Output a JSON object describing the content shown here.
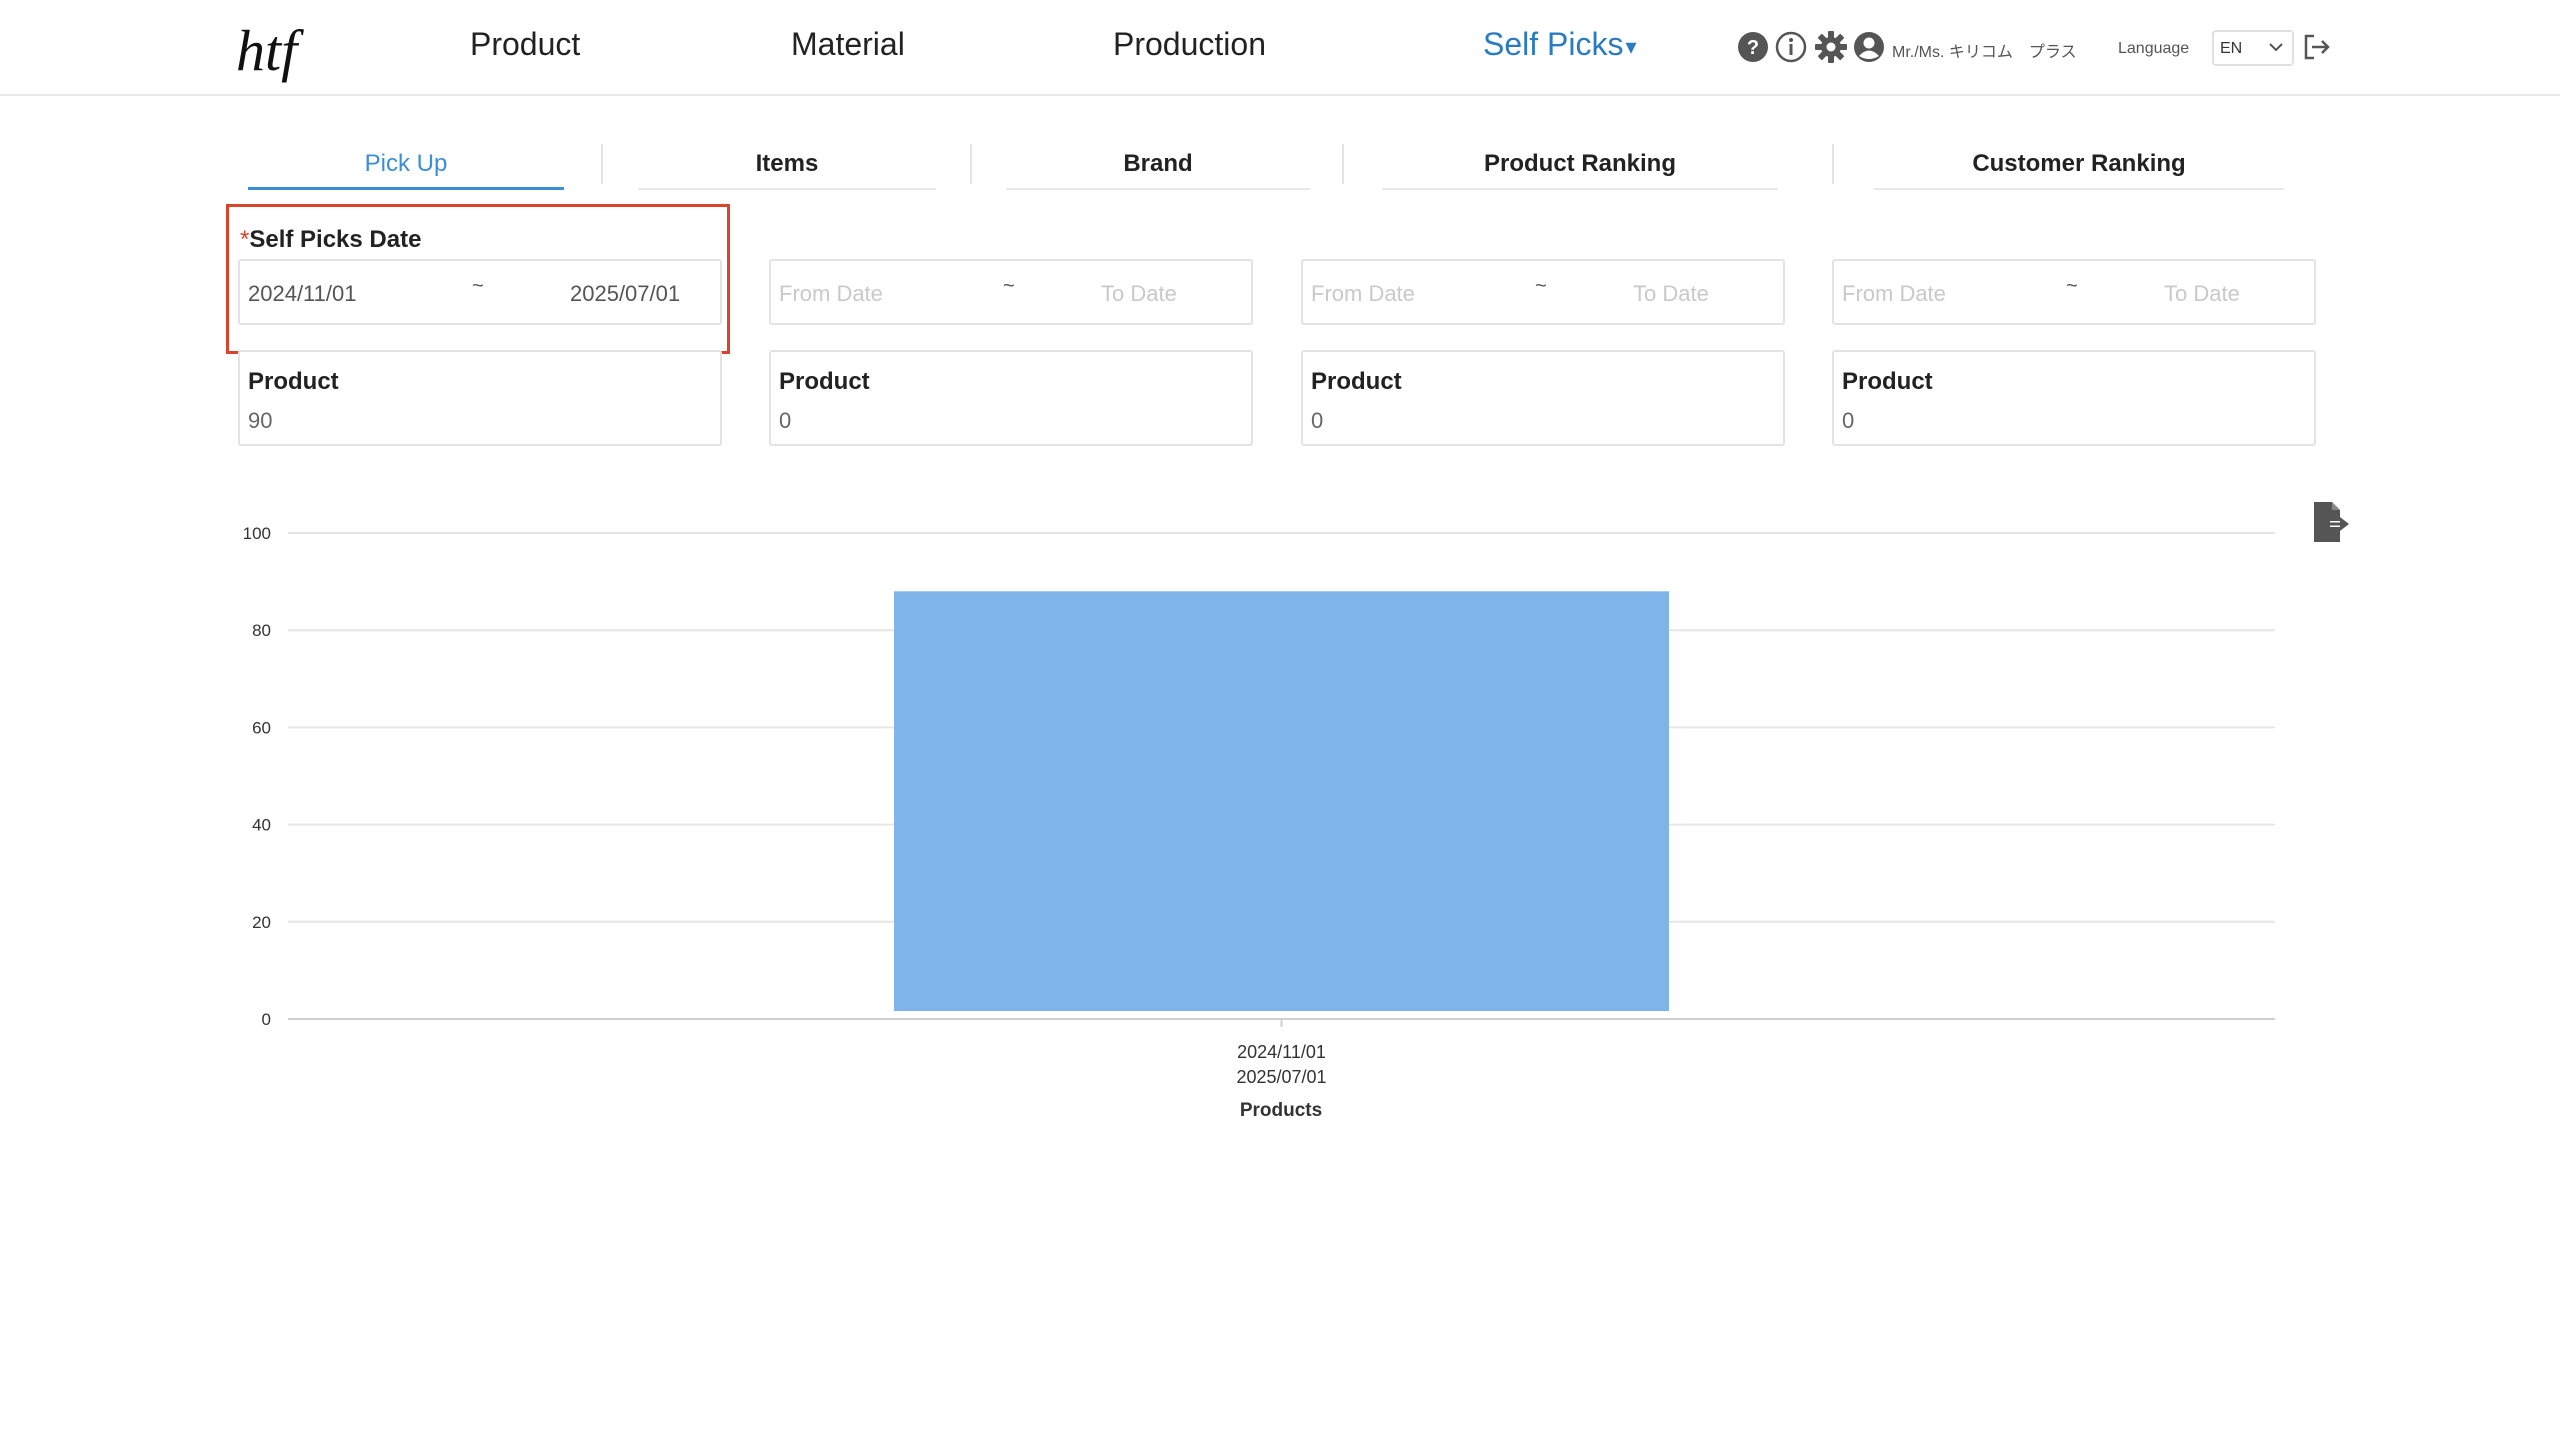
{
  "header": {
    "logo_text": "htf",
    "nav": [
      {
        "label": "Product"
      },
      {
        "label": "Material"
      },
      {
        "label": "Production"
      },
      {
        "label": "Self Picks",
        "caret": "▾"
      }
    ],
    "icons": [
      "help-icon",
      "info-icon",
      "gear-icon",
      "user-icon"
    ],
    "user_name": "Mr./Ms. キリコム　プラス",
    "language_label": "Language",
    "language_value": "EN",
    "logout_icon": "logout-icon"
  },
  "tabs": [
    {
      "label": "Pick Up",
      "active": true
    },
    {
      "label": "Items"
    },
    {
      "label": "Brand"
    },
    {
      "label": "Product Ranking"
    },
    {
      "label": "Customer Ranking"
    }
  ],
  "filters": {
    "label": "Self Picks Date",
    "required_mark": "*",
    "ranges": [
      {
        "from": "2024/11/01",
        "to": "2025/07/01"
      },
      {
        "from_placeholder": "From Date",
        "to_placeholder": "To Date"
      },
      {
        "from_placeholder": "From Date",
        "to_placeholder": "To Date"
      },
      {
        "from_placeholder": "From Date",
        "to_placeholder": "To Date"
      }
    ],
    "tilde": "~"
  },
  "cards": [
    {
      "label": "Product",
      "value": "90"
    },
    {
      "label": "Product",
      "value": "0"
    },
    {
      "label": "Product",
      "value": "0"
    },
    {
      "label": "Product",
      "value": "0"
    }
  ],
  "colors": {
    "accent": "#3a8fd6",
    "highlight": "#d9442a",
    "bar": "#7eb4ea"
  },
  "chart_data": {
    "type": "bar",
    "categories": [
      [
        "2024/11/01",
        "2025/07/01"
      ]
    ],
    "values": [
      88
    ],
    "xlabel": "Products",
    "ylabel": "",
    "ylim": [
      0,
      100
    ],
    "yticks": [
      0,
      20,
      40,
      60,
      80,
      100
    ],
    "grid": true
  }
}
